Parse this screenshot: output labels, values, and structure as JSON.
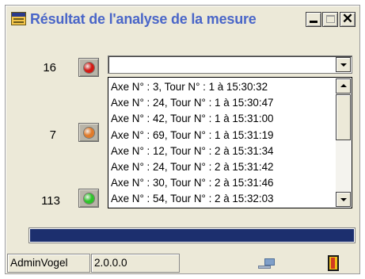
{
  "window": {
    "title": "Résultat de l'analyse de la mesure",
    "controls": {
      "close_glyph": "✕"
    }
  },
  "counters": [
    {
      "value": "16",
      "led_color": "#d21a14"
    },
    {
      "value": "7",
      "led_color": "#e07a2a"
    },
    {
      "value": "113",
      "led_color": "#2ec42a"
    }
  ],
  "combo": {
    "value": ""
  },
  "list": {
    "items": [
      "Axe N° : 3, Tour N° : 1 à 15:30:32",
      "Axe N° : 24, Tour N° : 1 à 15:30:47",
      "Axe N° : 42, Tour N° : 1 à 15:31:00",
      "Axe N° : 69, Tour N° : 1 à 15:31:19",
      "Axe N° : 12, Tour N° : 2 à 15:31:34",
      "Axe N° : 24, Tour N° : 2 à 15:31:42",
      "Axe N° : 30, Tour N° : 2 à 15:31:46",
      "Axe N° : 54, Tour N° : 2 à 15:32:03"
    ]
  },
  "progress": {
    "fraction": 1.0,
    "color": "#1c2f6e"
  },
  "status_bar": {
    "user": "AdminVogel",
    "version": "2.0.0.0",
    "network_icon": "network-computer-icon",
    "exit_icon": "exit-door-icon"
  }
}
